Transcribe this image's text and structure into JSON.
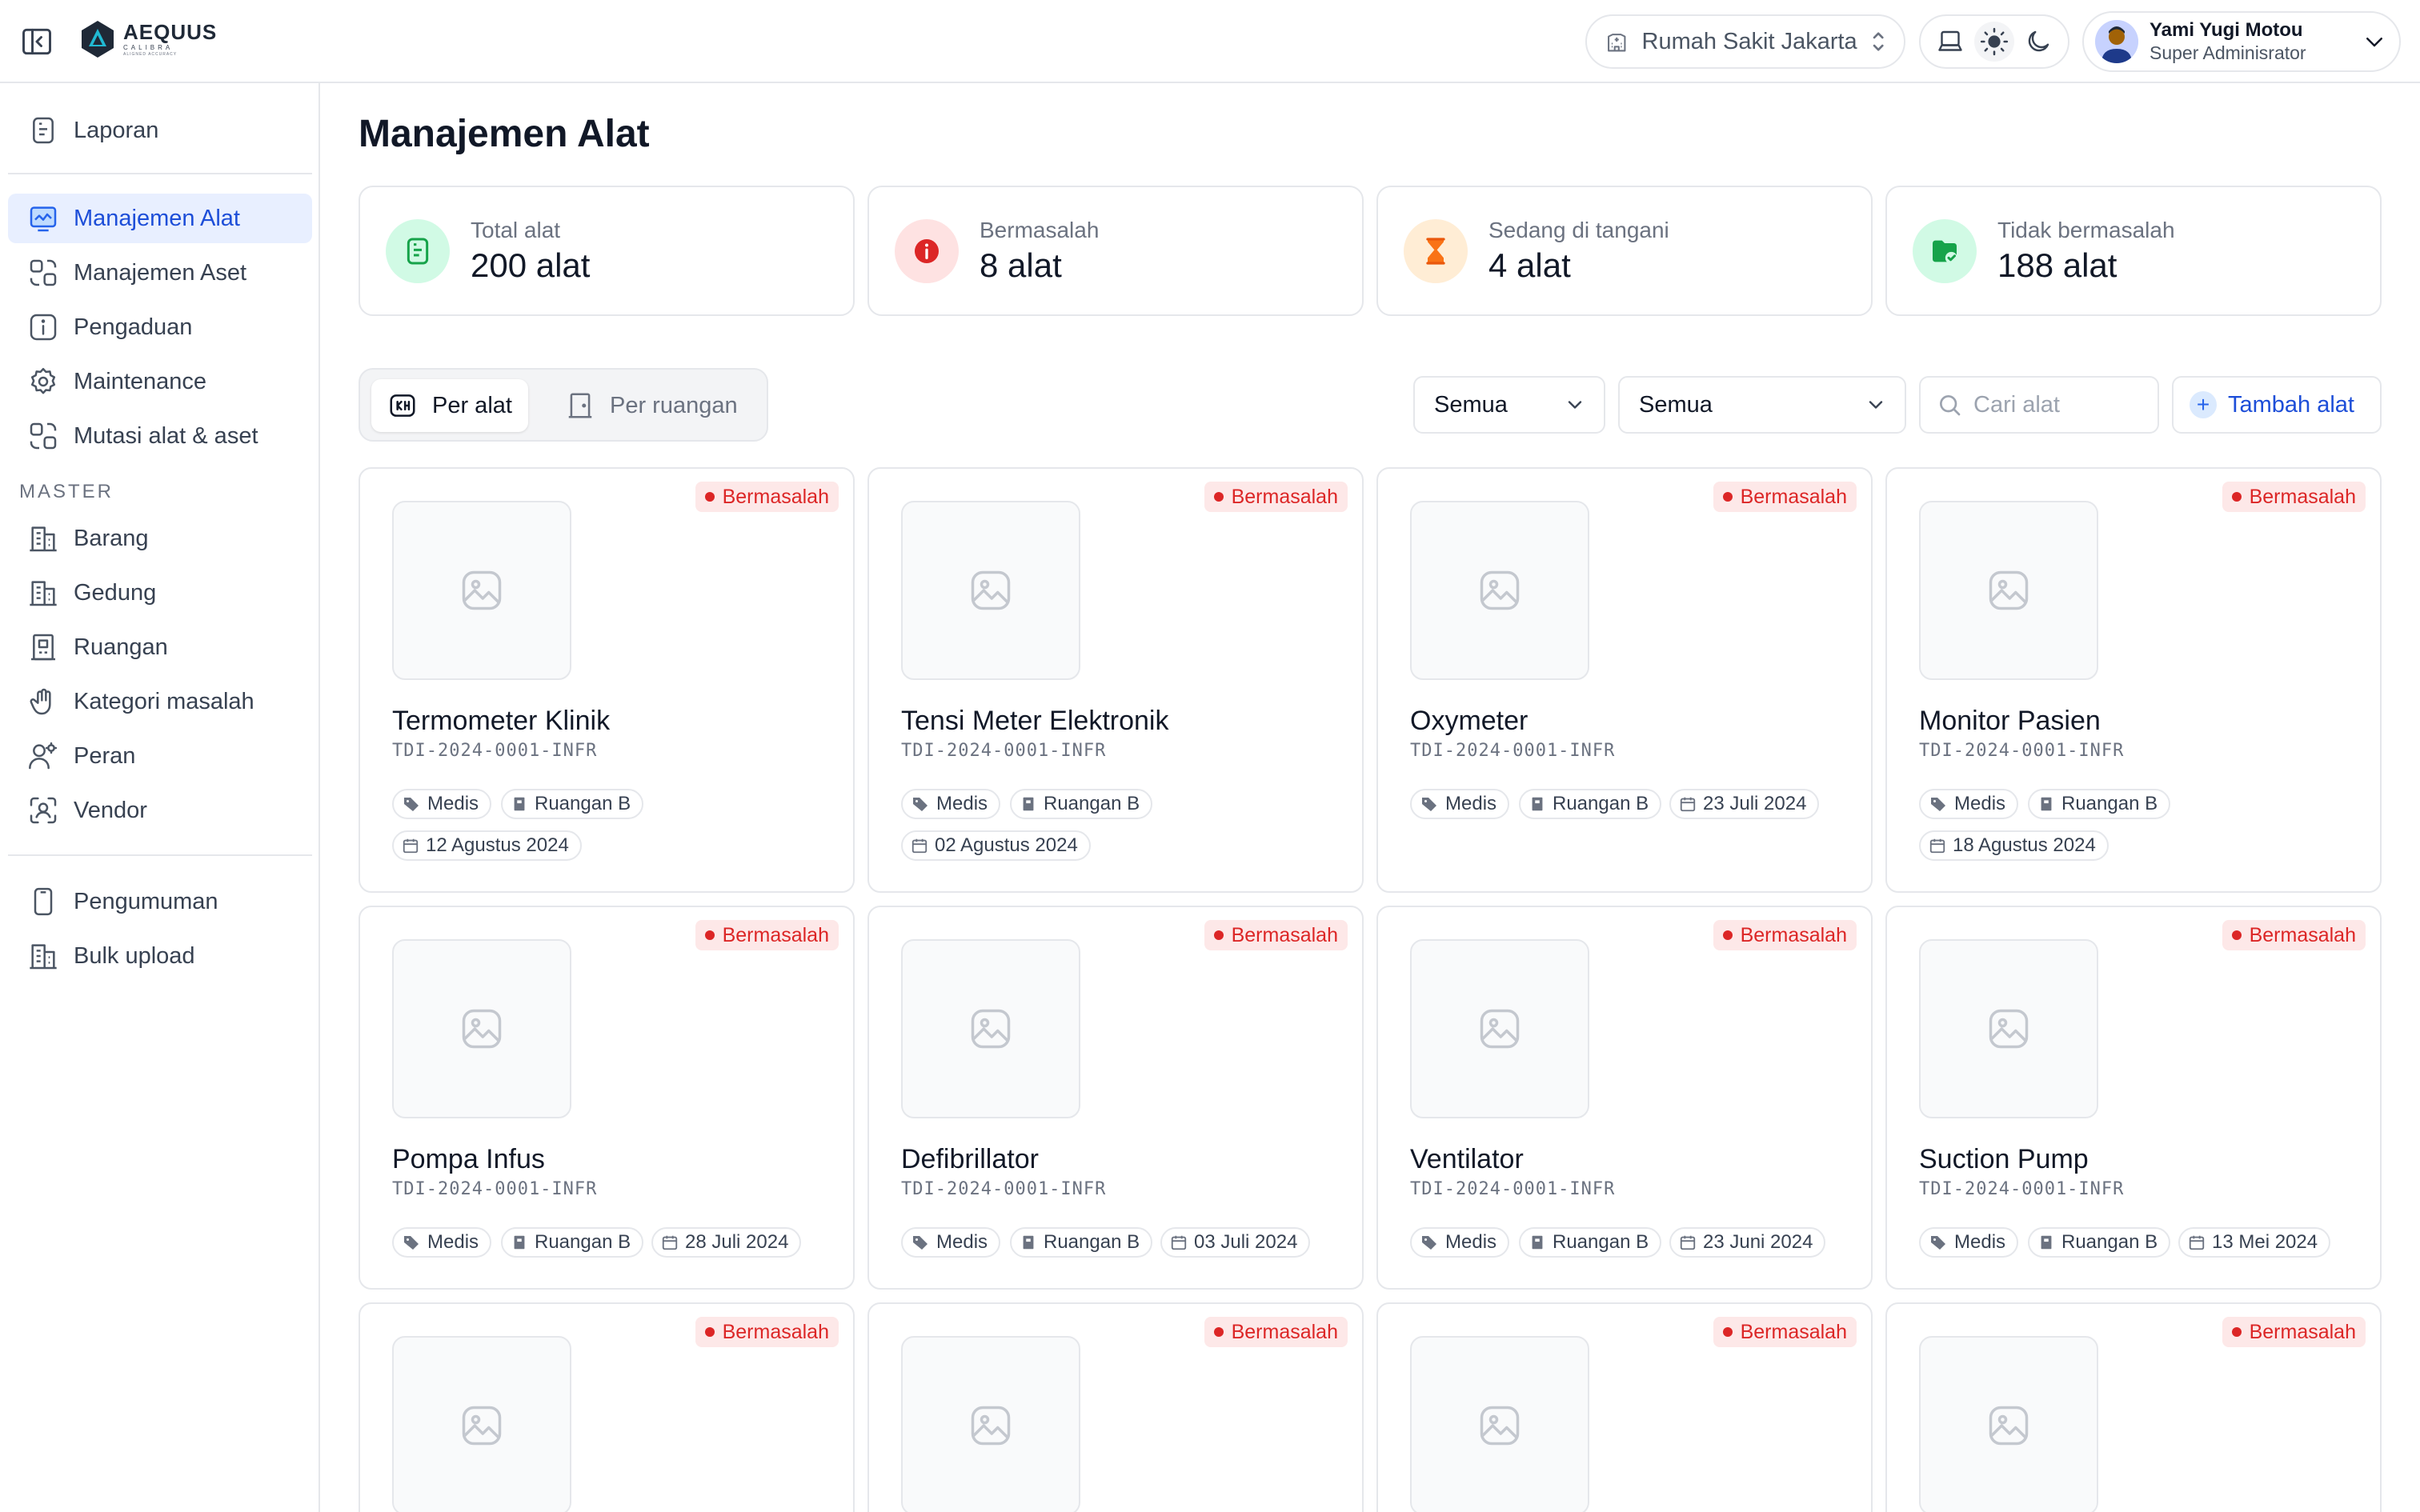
{
  "brand": {
    "name": "AEQUUS",
    "sub": "CALIBRA",
    "tagline": "ALIGNED ACCURACY"
  },
  "header": {
    "hospital": "Rumah Sakit Jakarta",
    "user": {
      "name": "Yami Yugi Motou",
      "role": "Super Adminisrator"
    }
  },
  "sidebar": {
    "laporan": "Laporan",
    "manajemen_alat": "Manajemen Alat",
    "manajemen_aset": "Manajemen Aset",
    "pengaduan": "Pengaduan",
    "maintenance": "Maintenance",
    "mutasi": "Mutasi alat & aset",
    "master_label": "MASTER",
    "barang": "Barang",
    "gedung": "Gedung",
    "ruangan": "Ruangan",
    "kategori": "Kategori masalah",
    "peran": "Peran",
    "vendor": "Vendor",
    "pengumuman": "Pengumuman",
    "bulk_upload": "Bulk upload"
  },
  "page": {
    "title": "Manajemen Alat"
  },
  "stats": [
    {
      "label": "Total alat",
      "value": "200 alat"
    },
    {
      "label": "Bermasalah",
      "value": "8 alat"
    },
    {
      "label": "Sedang di tangani",
      "value": "4 alat"
    },
    {
      "label": "Tidak bermasalah",
      "value": "188 alat"
    }
  ],
  "colors": {
    "accent": "#2563eb",
    "danger": "#dc2626",
    "warning": "#f97316",
    "success": "#16a34a"
  },
  "toolbar": {
    "view_per_alat": "Per alat",
    "view_per_ruangan": "Per ruangan",
    "filter_1": "Semua",
    "filter_2": "Semua",
    "search_placeholder": "Cari alat",
    "add_label": "Tambah alat"
  },
  "cards": [
    {
      "name": "Termometer Klinik",
      "code": "TDI-2024-0001-INFR",
      "status": "Bermasalah",
      "category": "Medis",
      "room": "Ruangan B",
      "date": "12 Agustus 2024"
    },
    {
      "name": "Tensi Meter Elektronik",
      "code": "TDI-2024-0001-INFR",
      "status": "Bermasalah",
      "category": "Medis",
      "room": "Ruangan B",
      "date": "02 Agustus 2024"
    },
    {
      "name": "Oxymeter",
      "code": "TDI-2024-0001-INFR",
      "status": "Bermasalah",
      "category": "Medis",
      "room": "Ruangan B",
      "date": "23 Juli 2024"
    },
    {
      "name": "Monitor Pasien",
      "code": "TDI-2024-0001-INFR",
      "status": "Bermasalah",
      "category": "Medis",
      "room": "Ruangan B",
      "date": "18 Agustus 2024"
    },
    {
      "name": "Pompa Infus",
      "code": "TDI-2024-0001-INFR",
      "status": "Bermasalah",
      "category": "Medis",
      "room": "Ruangan B",
      "date": "28 Juli 2024"
    },
    {
      "name": "Defibrillator",
      "code": "TDI-2024-0001-INFR",
      "status": "Bermasalah",
      "category": "Medis",
      "room": "Ruangan B",
      "date": "03 Juli 2024"
    },
    {
      "name": "Ventilator",
      "code": "TDI-2024-0001-INFR",
      "status": "Bermasalah",
      "category": "Medis",
      "room": "Ruangan B",
      "date": "23 Juni 2024"
    },
    {
      "name": "Suction Pump",
      "code": "TDI-2024-0001-INFR",
      "status": "Bermasalah",
      "category": "Medis",
      "room": "Ruangan B",
      "date": "13 Mei 2024"
    },
    {
      "status": "Bermasalah"
    },
    {
      "status": "Bermasalah"
    },
    {
      "status": "Bermasalah"
    },
    {
      "status": "Bermasalah"
    }
  ]
}
